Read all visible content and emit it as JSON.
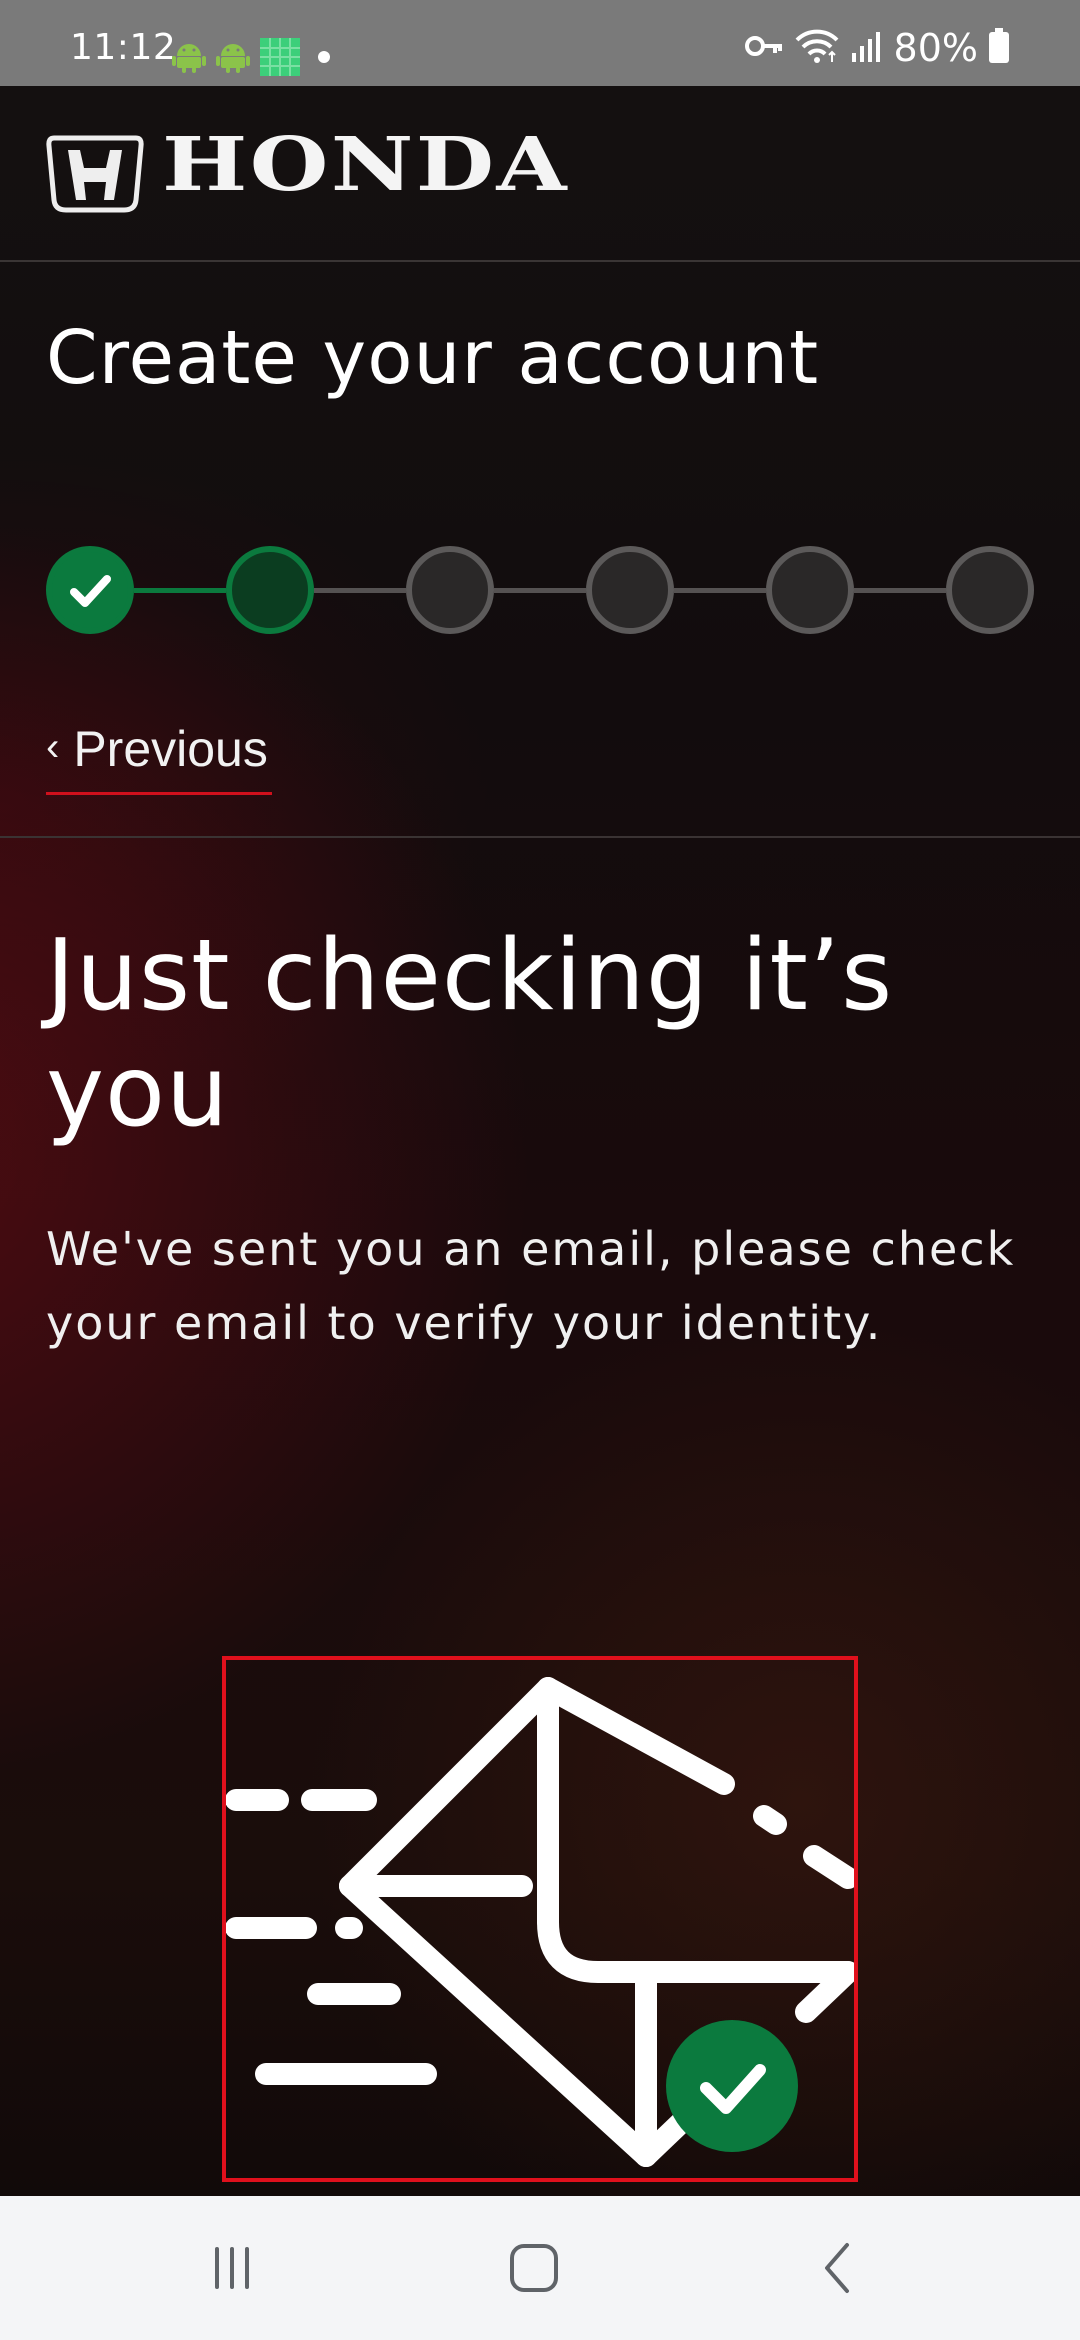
{
  "status_bar": {
    "time": "11:12",
    "battery_percent": "80%",
    "icons": [
      "android-icon",
      "android-icon",
      "app-grid-icon",
      "notification-dot-icon",
      "vpn-key-icon",
      "wifi-icon",
      "signal-icon",
      "battery-icon"
    ]
  },
  "header": {
    "brand": "HONDA"
  },
  "registration": {
    "title": "Create your account",
    "steps": [
      {
        "state": "complete"
      },
      {
        "state": "current"
      },
      {
        "state": "pending"
      },
      {
        "state": "pending"
      },
      {
        "state": "pending"
      },
      {
        "state": "pending"
      }
    ],
    "previous_label": "Previous"
  },
  "content": {
    "heading": "Just checking it’s you",
    "body": "We've sent you an email, please check your email to verify your identity.",
    "illustration_icon": "email-sent-check-icon"
  },
  "colors": {
    "accent_green": "#0b7a3e",
    "accent_red": "#d0101c",
    "status_bar_bg": "#7a7a7a",
    "nav_bar_bg": "#f4f5f7"
  },
  "nav_bar": {
    "buttons": [
      "recent-apps-icon",
      "home-icon",
      "back-icon"
    ]
  }
}
